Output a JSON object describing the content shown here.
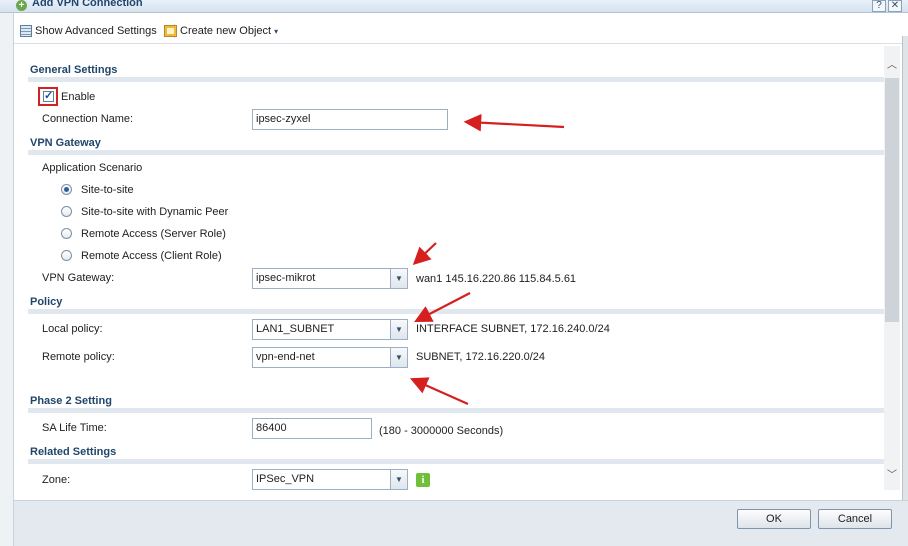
{
  "window": {
    "title": "Add VPN Connection",
    "help_label": "?",
    "close_label": "✕"
  },
  "toolbar": {
    "show_advanced": "Show Advanced Settings",
    "create_object": "Create new Object",
    "create_caret": "▾"
  },
  "general": {
    "heading": "General Settings",
    "enable_label": "Enable",
    "enable_checked": true,
    "enable_mark": "✓",
    "connection_name_label": "Connection Name:",
    "connection_name_value": "ipsec-zyxel"
  },
  "vpn_gateway": {
    "heading": "VPN Gateway",
    "scenario_label": "Application Scenario",
    "scenarios": [
      {
        "label": "Site-to-site",
        "selected": true
      },
      {
        "label": "Site-to-site with Dynamic Peer",
        "selected": false
      },
      {
        "label": "Remote Access (Server Role)",
        "selected": false
      },
      {
        "label": "Remote Access (Client Role)",
        "selected": false
      }
    ],
    "gateway_label": "VPN Gateway:",
    "gateway_value": "ipsec-mikrot",
    "gateway_info": "wan1 145.16.220.86 115.84.5.61"
  },
  "policy": {
    "heading": "Policy",
    "local_label": "Local policy:",
    "local_value": "LAN1_SUBNET",
    "local_info": "INTERFACE SUBNET, 172.16.240.0/24",
    "remote_label": "Remote policy:",
    "remote_value": "vpn-end-net",
    "remote_info": "SUBNET, 172.16.220.0/24"
  },
  "phase2": {
    "heading": "Phase 2 Setting",
    "sa_label": "SA Life Time:",
    "sa_value": "86400",
    "sa_hint": "(180 - 3000000 Seconds)"
  },
  "related": {
    "heading": "Related Settings",
    "zone_label": "Zone:",
    "zone_value": "IPSec_VPN",
    "info_glyph": "i"
  },
  "footer": {
    "ok_label": "OK",
    "cancel_label": "Cancel"
  },
  "icons": {
    "add": "add-circle-icon",
    "advanced": "settings-list-icon",
    "create": "create-object-icon",
    "dropdown": "chevron-down-icon",
    "info": "info-icon"
  },
  "colors": {
    "heading": "#21466c",
    "annotation_arrow": "#d61f1f",
    "info_icon": "#6fbf3a",
    "footer_bg": "#e3e9ef"
  }
}
